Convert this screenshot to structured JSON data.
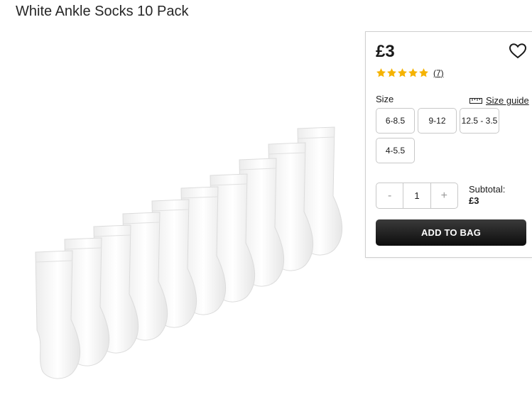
{
  "product": {
    "title": "White Ankle Socks 10 Pack"
  },
  "buybox": {
    "price": "£3",
    "review_count": "(7)",
    "rating": 5,
    "rating_max": 5,
    "star_color": "#f5b301",
    "size_label": "Size",
    "size_guide_label": "Size guide",
    "sizes": [
      "6-8.5",
      "9-12",
      "12.5 - 3.5",
      "4-5.5"
    ],
    "quantity": {
      "minus": "-",
      "value": "1",
      "plus": "+"
    },
    "subtotal_label": "Subtotal:",
    "subtotal_value": "£3",
    "add_to_bag_label": "ADD TO BAG"
  },
  "icons": {
    "wishlist": "heart-outline-icon",
    "size_guide": "ruler-icon",
    "rating": "star-icon"
  }
}
